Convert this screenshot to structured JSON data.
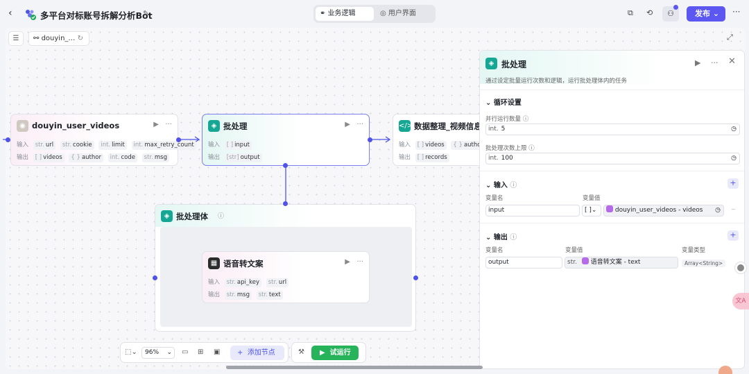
{
  "header": {
    "title": "多平台对标账号拆解分析Bot",
    "tabs": [
      {
        "label": "业务逻辑"
      },
      {
        "label": "用户界面"
      }
    ],
    "publish_label": "发布"
  },
  "canvas": {
    "chip_label": "douyin_…",
    "zoom": "96%",
    "add_node_label": "添加节点",
    "run_label": "试运行"
  },
  "nodes": {
    "douyin": {
      "title": "douyin_user_videos",
      "input_label": "输入",
      "output_label": "输出",
      "inputs": [
        {
          "type": "str.",
          "name": "url"
        },
        {
          "type": "str.",
          "name": "cookie"
        },
        {
          "type": "int.",
          "name": "limit"
        },
        {
          "type": "int.",
          "name": "max_retry_count"
        }
      ],
      "outputs": [
        {
          "type": "[ ]",
          "name": "videos"
        },
        {
          "type": "{ }",
          "name": "author"
        },
        {
          "type": "int.",
          "name": "code"
        },
        {
          "type": "str.",
          "name": "msg"
        }
      ]
    },
    "batch": {
      "title": "批处理",
      "input_label": "输入",
      "output_label": "输出",
      "inputs": [
        {
          "type": "[ ]",
          "name": "input"
        }
      ],
      "outputs": [
        {
          "type": "[str]",
          "name": "output"
        }
      ]
    },
    "data": {
      "title": "数据整理_视频信息",
      "input_label": "输入",
      "output_label": "输出",
      "inputs": [
        {
          "type": "[ ]",
          "name": "videos"
        },
        {
          "type": "{ }",
          "name": "author"
        }
      ],
      "outputs": [
        {
          "type": "[ ]",
          "name": "records"
        }
      ]
    },
    "body": {
      "title": "批处理体"
    },
    "speech": {
      "title": "语音转文案",
      "input_label": "输入",
      "output_label": "输出",
      "inputs": [
        {
          "type": "str.",
          "name": "api_key"
        },
        {
          "type": "str.",
          "name": "url"
        }
      ],
      "outputs": [
        {
          "type": "str.",
          "name": "msg"
        },
        {
          "type": "str.",
          "name": "text"
        }
      ]
    }
  },
  "panel": {
    "title": "批处理",
    "description": "通过设定批量运行次数和逻辑，运行批处理体内的任务",
    "loop_section": "循环设置",
    "parallel_label": "并行运行数量",
    "parallel_type": "int.",
    "parallel_value": "5",
    "limit_label": "批处理次数上限",
    "limit_type": "int.",
    "limit_value": "100",
    "input_section": "输入",
    "var_name_label": "变量名",
    "var_value_label": "变量值",
    "input_var_name": "input",
    "input_var_type": "[ ]",
    "input_var_value": "douyin_user_videos - videos",
    "output_section": "输出",
    "var_type_label": "变量类型",
    "output_var_name": "output",
    "output_var_type_prefix": "str.",
    "output_var_value": "语音转文案 - text",
    "output_var_type": "Array<String>"
  }
}
